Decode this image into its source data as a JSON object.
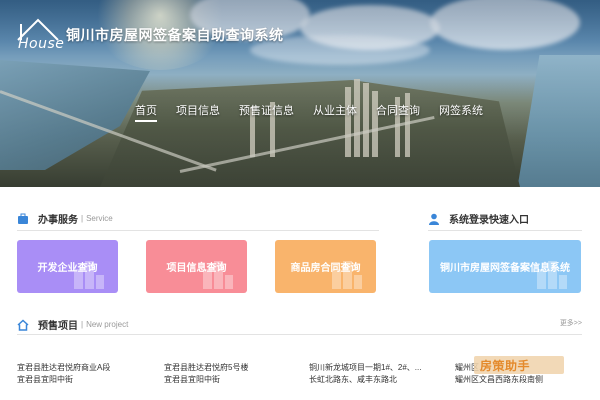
{
  "header": {
    "logo_text": "House",
    "site_title": "铜川市房屋网签备案自助查询系统"
  },
  "nav": {
    "items": [
      {
        "label": "首页",
        "active": true
      },
      {
        "label": "项目信息",
        "active": false
      },
      {
        "label": "预售证信息",
        "active": false
      },
      {
        "label": "从业主体",
        "active": false
      },
      {
        "label": "合同查询",
        "active": false
      },
      {
        "label": "网签系统",
        "active": false
      }
    ]
  },
  "services": {
    "title": "办事服务",
    "subtitle": "Service",
    "cards": [
      {
        "label": "开发企业查询",
        "color": "#a98ef6"
      },
      {
        "label": "项目信息查询",
        "color": "#f88d97"
      },
      {
        "label": "商品房合同查询",
        "color": "#f9b46c"
      }
    ]
  },
  "login": {
    "title": "系统登录快速入口",
    "card": {
      "label": "铜川市房屋网签备案信息系统",
      "color": "#8cc7f5"
    }
  },
  "presale": {
    "title": "预售项目",
    "subtitle": "New project",
    "more": "更多>>",
    "projects": [
      {
        "line1": "宜君县胜达君悦府商业A段",
        "line2": "宜君县宜阳中街"
      },
      {
        "line1": "宜君县胜达君悦府5号楼",
        "line2": "宜君县宜阳中街"
      },
      {
        "line1": "铜川新龙城项目一期1#、2#、...",
        "line2": "长虹北路东、咸丰东路北"
      },
      {
        "line1": "耀州区...",
        "line2": "耀州区文昌西路东段南侧"
      }
    ]
  },
  "watermark": {
    "text": "房策助手"
  },
  "colors": {
    "accent_blue": "#3a86d8",
    "nav_text": "#ffffff",
    "section_title": "#333333"
  }
}
